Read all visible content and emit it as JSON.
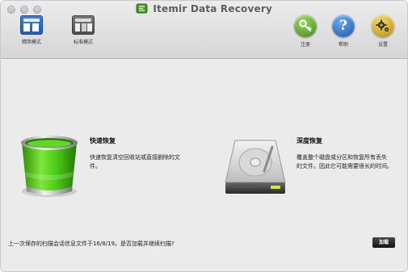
{
  "window": {
    "title": "Itemir Data Recovery"
  },
  "toolbar": {
    "simple_mode_label": "精简模式",
    "standard_mode_label": "标准模式",
    "register_label": "注册",
    "help_label": "帮助",
    "settings_label": "设置"
  },
  "quick_recovery": {
    "title": "快速恢复",
    "description_line1": "快速恢复清空回收站或直接删除的文",
    "description_line2": "件。"
  },
  "deep_recovery": {
    "title": "深度恢复",
    "description_line1": "覆盖整个磁盘或分区和恢复所有丢失",
    "description_line2": "的文件。因此它可能需要很长的时间。"
  },
  "status_text": "上一次保存的扫描会话信息文件于16/8/19。是否加载并继续扫描?",
  "load_button_label": "加载",
  "icons": {
    "simple_mode": "simple-mode-icon",
    "standard_mode": "standard-mode-icon",
    "register": "key-icon",
    "help": "question-icon",
    "settings": "gear-icon",
    "quick_recovery": "trash-bin-icon",
    "deep_recovery": "hard-drive-icon"
  },
  "colors": {
    "bin_green": "#4fcf1a",
    "drive_led": "#c8f02a",
    "button_dark": "#1f1f1f"
  }
}
